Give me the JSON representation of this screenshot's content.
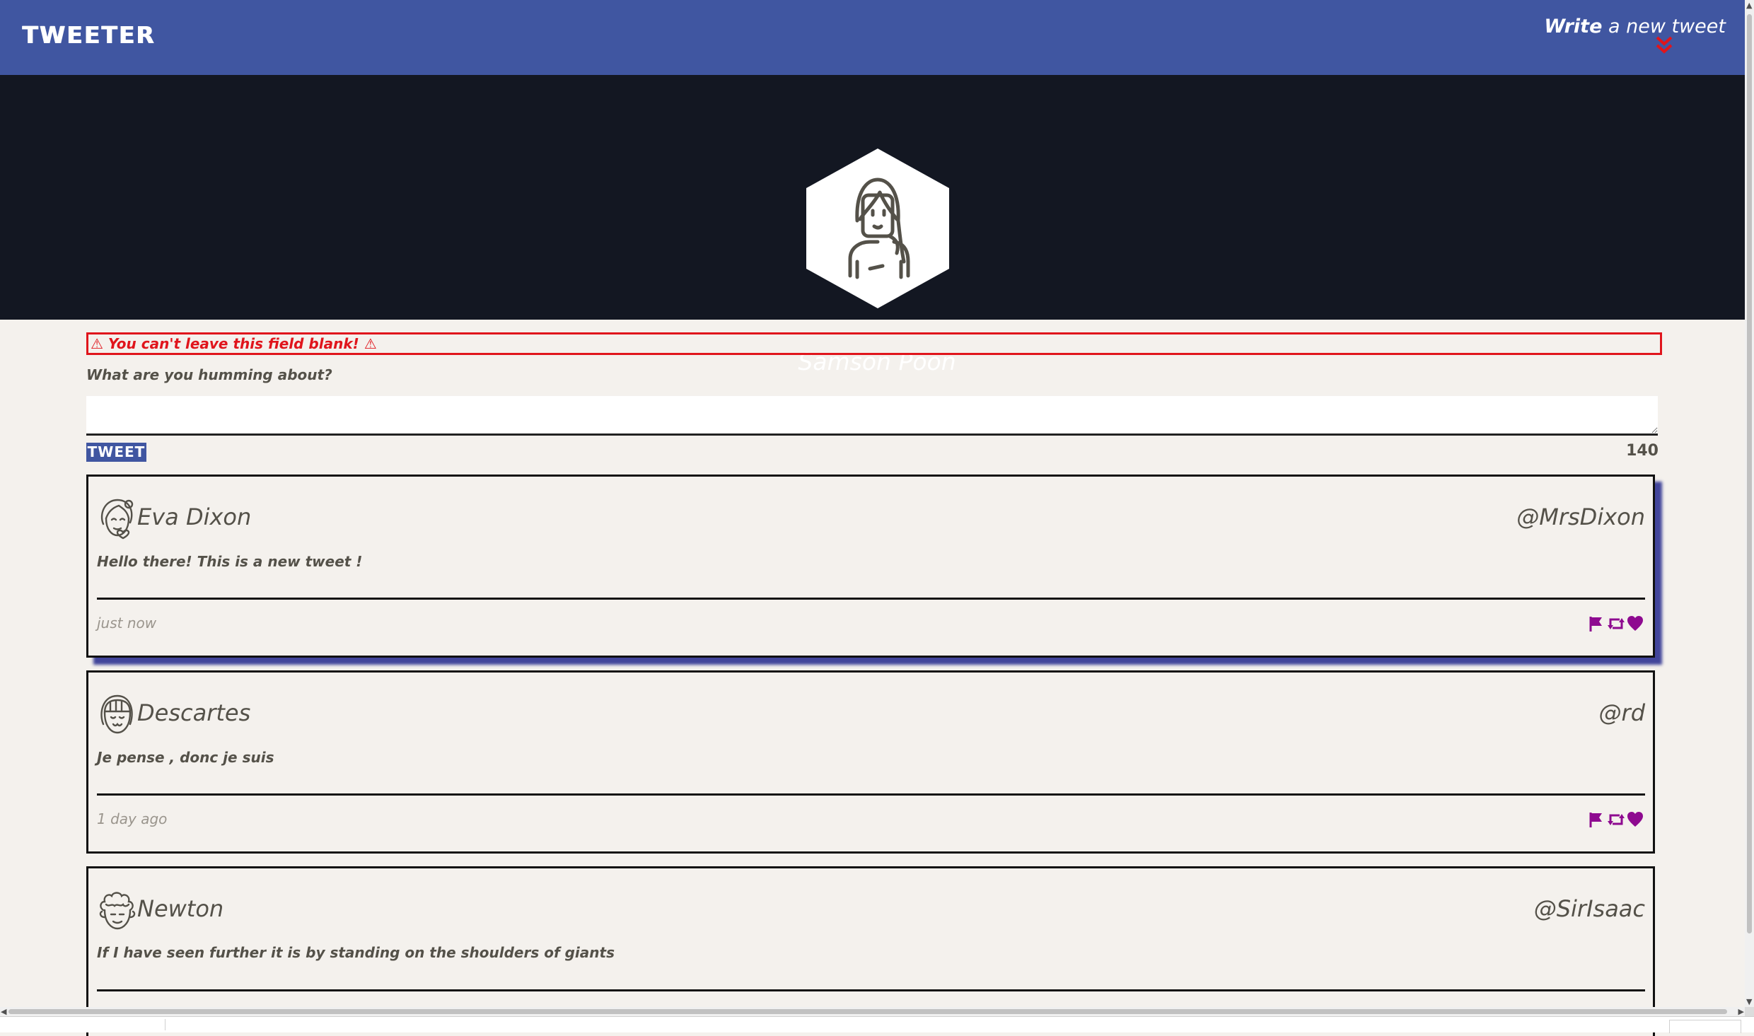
{
  "nav": {
    "brand": "TWEETER",
    "write_bold": "Write",
    "write_rest": "a new tweet"
  },
  "profile": {
    "name": "Samson Poon"
  },
  "compose": {
    "error": "⚠ You can't leave this field blank! ⚠",
    "prompt": "What are you humming about?",
    "value": "",
    "button_label": "TWEET",
    "counter": "140"
  },
  "tweets": [
    {
      "name": "Eva Dixon",
      "handle": "@MrsDixon",
      "content": "Hello there! This is a new tweet !",
      "time": "just now",
      "avatar_icon": "woman-avatar-icon"
    },
    {
      "name": "Descartes",
      "handle": "@rd",
      "content": "Je pense , donc je suis",
      "time": "1 day ago",
      "avatar_icon": "bangs-avatar-icon"
    },
    {
      "name": "Newton",
      "handle": "@SirIsaac",
      "content": "If I have seen further it is by standing on the shoulders of giants",
      "time": "",
      "avatar_icon": "curly-hair-avatar-icon"
    }
  ],
  "icons": {
    "flag": "flag-icon",
    "retweet": "retweet-icon",
    "like": "heart-icon",
    "scroll_down": "chevron-double-down-icon"
  },
  "colors": {
    "nav_bg": "#4056a1",
    "header_bg": "#131722",
    "page_bg": "#f4f1ed",
    "error": "#e0151c",
    "action_icons": "#8e0a90",
    "text": "#545149"
  }
}
